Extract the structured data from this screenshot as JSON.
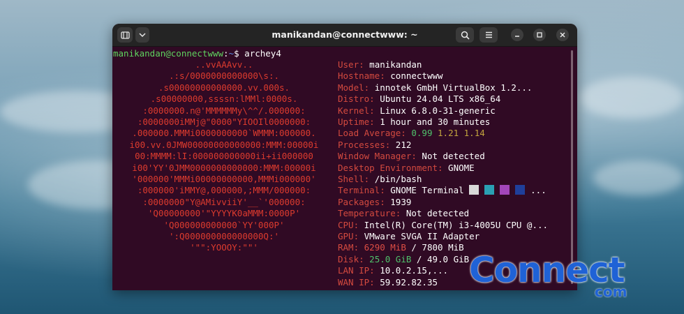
{
  "window": {
    "title": "manikandan@connectwww: ~",
    "new_tab_icon": "terminal-tab-icon",
    "dropdown_icon": "chevron-down-icon",
    "search_icon": "search-icon",
    "menu_icon": "hamburger-menu-icon",
    "minimize_icon": "minimize-icon",
    "maximize_icon": "maximize-icon",
    "close_icon": "close-icon"
  },
  "prompt": {
    "user_host": "manikandan@connectwww",
    "sep": ":",
    "path": "~",
    "dollar": "$ ",
    "command": "archey4"
  },
  "logo_lines": [
    "..vvAAAvv..",
    ".:s/0000000000000\\s:.",
    ".s00000000000000.vv.000s.",
    ".s00000000,ssssn:lMMl:0000s.",
    ":0000000.n@'MMMMMMy\\^^/.000000:",
    ":0000000iMMj@\"0000\"YIOOIl0000000:",
    ".000000.MMMi0000000000`WMMM:000000.",
    "i00.vv.0JMW00000000000000:MMM:00000i",
    "00:MMMM:lI:000000000000ii+ii000000",
    "i00'YY'0JMM0000000000000:MMM:00000i",
    "'000000'MMMi00000000000,MMMi000000'",
    ":000000'iMMY@,000000,;MMM/000000:",
    ":0000000\"Y@AMivviiY'__`'000000:",
    "'Q00000000'\"YYYYK0aMMM:0000P'",
    "'Q000000000000`YY'000P'",
    "':Q000000000000000Q:'",
    "'\"\":YOOOY:\"\"'"
  ],
  "info": [
    {
      "label": "User:",
      "value": "manikandan"
    },
    {
      "label": "Hostname:",
      "value": "connectwww"
    },
    {
      "label": "Model:",
      "value": "innotek GmbH VirtualBox 1.2..."
    },
    {
      "label": "Distro:",
      "value": "Ubuntu 24.04 LTS x86_64"
    },
    {
      "label": "Kernel:",
      "value": "Linux 6.8.0-31-generic"
    },
    {
      "label": "Uptime:",
      "value": "1 hour and 30 minutes"
    },
    {
      "label": "Load Average:",
      "load": [
        "0.99",
        "1.21",
        "1.14"
      ]
    },
    {
      "label": "Processes:",
      "value": "212"
    },
    {
      "label": "Window Manager:",
      "value": "Not detected"
    },
    {
      "label": "Desktop Environment:",
      "value": "GNOME"
    },
    {
      "label": "Shell:",
      "value": "/bin/bash"
    },
    {
      "label": "Terminal:",
      "value": "GNOME Terminal",
      "swatches": [
        "#d8d8d8",
        "#2aa1b3",
        "#a347ba",
        "#1f3f9a"
      ],
      "suffix": "..."
    },
    {
      "label": "Packages:",
      "value": "1939"
    },
    {
      "label": "Temperature:",
      "value": "Not detected"
    },
    {
      "label": "CPU:",
      "value": "Intel(R) Core(TM) i3-4005U CPU @..."
    },
    {
      "label": "GPU:",
      "value": "VMware SVGA II Adapter"
    },
    {
      "label": "RAM:",
      "used": "6290 MiB",
      "total": " / 7800 MiB"
    },
    {
      "label": "Disk:",
      "used": "25.0 GiB",
      "total": " / 49.0 GiB"
    },
    {
      "label": "LAN IP:",
      "value": "10.0.2.15,..."
    },
    {
      "label": "WAN IP:",
      "value": "59.92.82.35"
    }
  ],
  "watermark": {
    "main": "Connect",
    "sub": "com"
  },
  "colors": {
    "terminal_bg": "#300a24",
    "logo_red": "#dd3b2e",
    "label_red": "#d44a3f",
    "prompt_green": "#5fd35f",
    "prompt_blue": "#5c8ae6",
    "watermark_blue": "#1f62d6"
  }
}
